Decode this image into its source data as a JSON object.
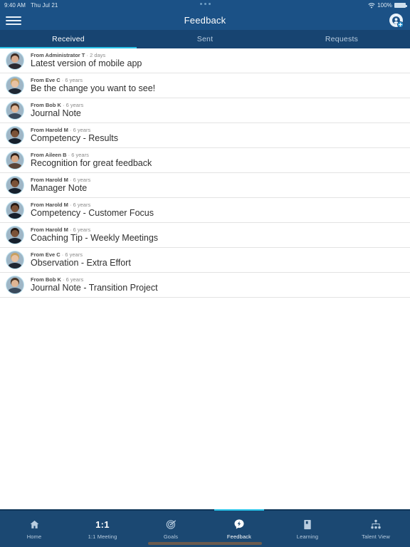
{
  "statusbar": {
    "time": "9:40 AM",
    "date": "Thu Jul 21",
    "wifi_icon": "wifi-icon",
    "battery_percent": "100%",
    "battery_icon": "battery-icon",
    "multitask_dots": "multitasking-dots-icon"
  },
  "header": {
    "menu_icon": "hamburger-menu-icon",
    "title": "Feedback",
    "action_icon": "add-feedback-icon"
  },
  "tabs": [
    {
      "label": "Received",
      "active": true
    },
    {
      "label": "Sent",
      "active": false
    },
    {
      "label": "Requests",
      "active": false
    }
  ],
  "feedback_items": [
    {
      "from": "From Administrator T",
      "sep": " · ",
      "age": "2 days",
      "title": "Latest version of mobile app",
      "skin": "#d8ab8e",
      "hair": "#3a2a22",
      "shirt": "#2b2b33"
    },
    {
      "from": "From Eve C",
      "sep": " · ",
      "age": "6 years",
      "title": "Be the change you want to see!",
      "skin": "#e8c2a2",
      "hair": "#c8a060",
      "shirt": "#1f2733"
    },
    {
      "from": "From Bob K",
      "sep": " · ",
      "age": "6 years",
      "title": "Journal Note",
      "skin": "#e0b594",
      "hair": "#4a3526",
      "shirt": "#3a4a5c"
    },
    {
      "from": "From Harold M",
      "sep": " · ",
      "age": "6 years",
      "title": "Competency - Results",
      "skin": "#7b5237",
      "hair": "#241812",
      "shirt": "#16202c"
    },
    {
      "from": "From Aileen B",
      "sep": " · ",
      "age": "6 years",
      "title": "Recognition for great feedback",
      "skin": "#d6a785",
      "hair": "#2e2018",
      "shirt": "#5a4438"
    },
    {
      "from": "From Harold M",
      "sep": " · ",
      "age": "6 years",
      "title": "Manager Note",
      "skin": "#7b5237",
      "hair": "#241812",
      "shirt": "#16202c"
    },
    {
      "from": "From Harold M",
      "sep": " · ",
      "age": "6 years",
      "title": "Competency - Customer Focus",
      "skin": "#7b5237",
      "hair": "#241812",
      "shirt": "#16202c"
    },
    {
      "from": "From Harold M",
      "sep": " · ",
      "age": "6 years",
      "title": "Coaching Tip - Weekly Meetings",
      "skin": "#7b5237",
      "hair": "#241812",
      "shirt": "#16202c"
    },
    {
      "from": "From Eve C",
      "sep": " · ",
      "age": "6 years",
      "title": "Observation - Extra Effort",
      "skin": "#e8c2a2",
      "hair": "#c8a060",
      "shirt": "#1f2733"
    },
    {
      "from": "From Bob K",
      "sep": " · ",
      "age": "6 years",
      "title": "Journal Note - Transition Project",
      "skin": "#e0b594",
      "hair": "#4a3526",
      "shirt": "#3a4a5c"
    }
  ],
  "bottom_nav": [
    {
      "label": "Home",
      "icon": "home-icon",
      "active": false
    },
    {
      "label": "1:1 Meeting",
      "icon": "one-on-one-icon",
      "icon_text": "1:1",
      "active": false
    },
    {
      "label": "Goals",
      "icon": "target-goals-icon",
      "active": false
    },
    {
      "label": "Feedback",
      "icon": "feedback-bubble-icon",
      "active": true
    },
    {
      "label": "Learning",
      "icon": "book-learning-icon",
      "active": false
    },
    {
      "label": "Talent View",
      "icon": "org-chart-icon",
      "active": false
    }
  ],
  "colors": {
    "header_blue": "#1b5186",
    "tabbar_blue": "#174471",
    "accent_cyan": "#29c3e8",
    "bottomnav_blue": "#1b4872",
    "avatar_ring": "#bfe4f2"
  }
}
